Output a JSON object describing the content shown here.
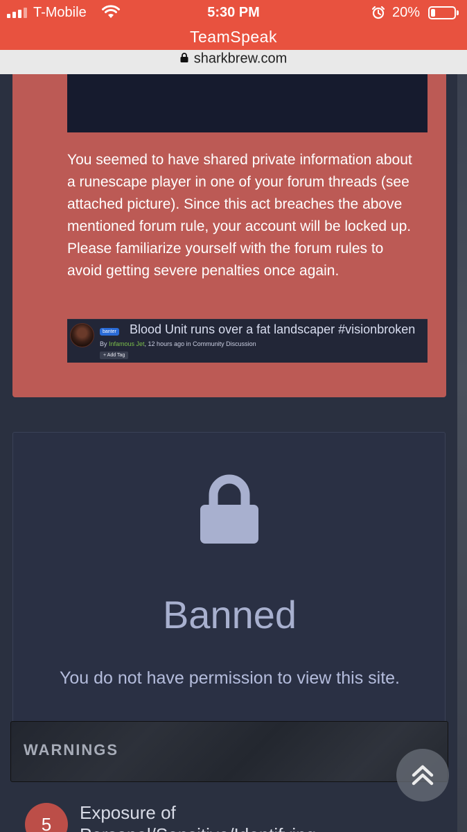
{
  "status_bar": {
    "carrier": "T-Mobile",
    "time": "5:30 PM",
    "battery_percent": "20%",
    "battery_level": 0.2,
    "signal_icon": "signal-icon",
    "wifi_icon": "wifi-icon",
    "alarm_icon": "alarm-icon"
  },
  "app": {
    "title": "TeamSpeak"
  },
  "browser": {
    "url": "sharkbrew.com",
    "lock_icon": "lock-icon"
  },
  "notice": {
    "text": "You seemed to have shared private information about a runescape player in one of your forum threads (see attached picture). Since this act breaches the above mentioned forum rule, your account will be locked up. Please familiarize yourself with the forum rules to avoid getting severe penalties once again.",
    "background": "#bc5a55",
    "attached_thread": {
      "badge": "banter",
      "title": "Blood Unit runs over a fat landscaper #visionbroken",
      "by_prefix": "By ",
      "author": "Infamous Jet",
      "meta_suffix": ", 12 hours ago in Community Discussion",
      "tag_button": "+ Add Tag"
    }
  },
  "banned": {
    "icon": "padlock-icon",
    "title": "Banned",
    "message": "You do not have permission to view this site."
  },
  "warnings": {
    "title": "WARNINGS",
    "items": [
      {
        "number": "5",
        "text": "Exposure of",
        "text_line2": "Personal/Sensitive/Identifying"
      }
    ]
  },
  "scroll_top": {
    "icon": "double-chevron-up-icon"
  },
  "colors": {
    "header": "#e8523f",
    "page_background": "#2a3040",
    "banned_text": "#a8b0cf",
    "warning_badge": "#bc4e48"
  }
}
